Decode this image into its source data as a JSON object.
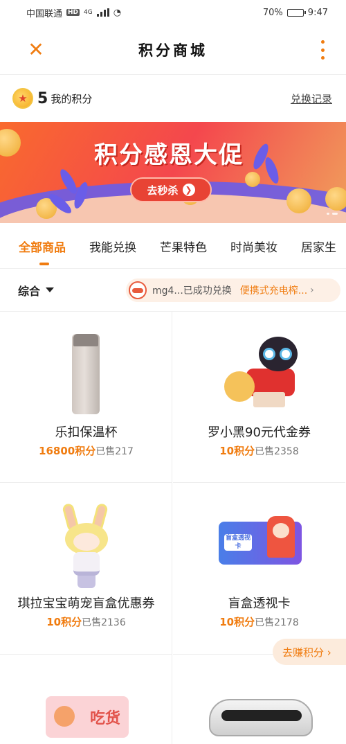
{
  "status_bar": {
    "carrier": "中国联通",
    "network_badge": "HD",
    "network_type": "4G",
    "battery": "70%",
    "time": "9:47"
  },
  "nav": {
    "title": "积分商城",
    "close_icon": "close-icon",
    "more_icon": "more-vertical-icon"
  },
  "points": {
    "value": "5",
    "label": "我的积分",
    "record_link": "兑换记录"
  },
  "banner": {
    "title": "积分感恩大促",
    "button": "去秒杀"
  },
  "tabs": [
    {
      "label": "全部商品",
      "active": true
    },
    {
      "label": "我能兑换",
      "active": false
    },
    {
      "label": "芒果特色",
      "active": false
    },
    {
      "label": "时尚美妆",
      "active": false
    },
    {
      "label": "居家生",
      "active": false
    }
  ],
  "filter": {
    "sort_label": "综合",
    "ticker_user": "mg4...已成功兑换",
    "ticker_product": "便携式充电榨...",
    "ticker_chevron": "›"
  },
  "products": [
    {
      "name": "乐扣保温杯",
      "points": "16800积分",
      "sold": "已售217"
    },
    {
      "name": "罗小黑90元代金券",
      "points": "10积分",
      "sold": "已售2358"
    },
    {
      "name": "琪拉宝宝萌宠盲盒优惠券",
      "points": "10积分",
      "sold": "已售2136"
    },
    {
      "name": "盲盒透视卡",
      "points": "10积分",
      "sold": "已售2178"
    }
  ],
  "product_art_text": {
    "card_tag": "盲盒透视卡",
    "snack_text": "吃货"
  },
  "earn_button": "去赚积分 ›",
  "colors": {
    "accent": "#f07c10",
    "banner_red": "#e84334",
    "banner_purple": "#6a5de8"
  }
}
